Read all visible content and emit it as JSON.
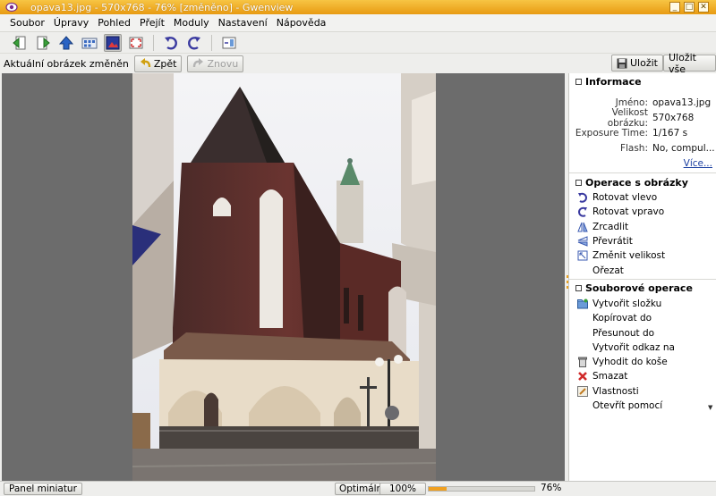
{
  "window": {
    "title": "opava13.jpg - 570x768 - 76% [změněno] - Gwenview",
    "controls": [
      "_",
      "□",
      "✕"
    ]
  },
  "menubar": {
    "items": [
      "Soubor",
      "Úpravy",
      "Pohled",
      "Přejít",
      "Moduly",
      "Nastavení",
      "Nápověda"
    ]
  },
  "toolbar": {
    "buttons": [
      "previous-icon",
      "next-icon",
      "up-icon",
      "browse-icon",
      "view-icon",
      "fullscreen-icon",
      "rotate-left-icon",
      "rotate-right-icon",
      "sidebar-icon"
    ]
  },
  "modbar": {
    "message": "Aktuální obrázek změněn",
    "undo_label": "Zpět",
    "redo_label": "Znovu",
    "save_label": "Uložit",
    "saveall_label": "Uložit vše"
  },
  "sidebar": {
    "info": {
      "title": "Informace",
      "rows": [
        {
          "key": "Jméno:",
          "value": "opava13.jpg"
        },
        {
          "key": "Velikost obrázku:",
          "value": "570x768"
        },
        {
          "key": "Exposure Time:",
          "value": "1/167 s"
        },
        {
          "key": "Flash:",
          "value": "No, compul..."
        }
      ],
      "more_label": "Více..."
    },
    "image_ops": {
      "title": "Operace s obrázky",
      "items": [
        "Rotovat vlevo",
        "Rotovat vpravo",
        "Zrcadlit",
        "Převrátit",
        "Změnit velikost",
        "Ořezat"
      ]
    },
    "file_ops": {
      "title": "Souborové operace",
      "items": [
        "Vytvořit složku",
        "Kopírovat do",
        "Přesunout do",
        "Vytvořit odkaz na",
        "Vyhodit do koše",
        "Smazat",
        "Vlastnosti",
        "Otevřít pomocí"
      ]
    }
  },
  "statusbar": {
    "thumbbar_label": "Panel miniatur",
    "fit_label": "Optimální",
    "zoom100_label": "100%",
    "zoom_value": "76%",
    "zoom_fraction": 0.17
  },
  "colors": {
    "titlebar": "#f0b030",
    "accent": "#f0a020",
    "viewer_bg": "#6c6c6c"
  }
}
